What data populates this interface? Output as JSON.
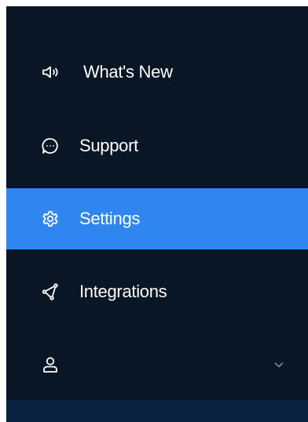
{
  "sidebar": {
    "items": [
      {
        "label": "What's New",
        "icon": "megaphone-icon",
        "active": false
      },
      {
        "label": "Support",
        "icon": "chat-bubble-icon",
        "active": false
      },
      {
        "label": "Settings",
        "icon": "gear-icon",
        "active": true
      },
      {
        "label": "Integrations",
        "icon": "share-nodes-icon",
        "active": false
      }
    ],
    "account": {
      "icon": "user-icon",
      "expand_icon": "chevron-down-icon"
    }
  },
  "colors": {
    "sidebar_background": "#081626",
    "active_background": "#2f86ee",
    "text": "#ffffff",
    "bottom_strip": "#0a2340"
  }
}
